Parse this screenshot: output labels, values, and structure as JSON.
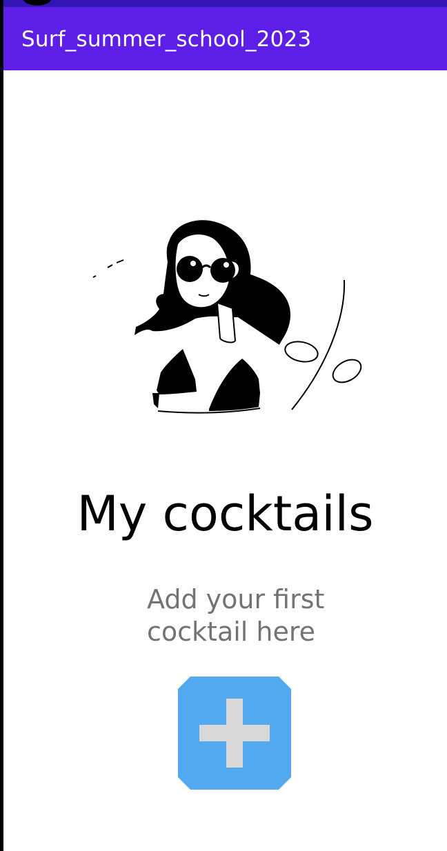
{
  "app_bar": {
    "title": "Surf_summer_school_2023"
  },
  "empty_state": {
    "title": "My cocktails",
    "subtitle_line1": "Add your first",
    "subtitle_line2": "cocktail here",
    "illustration_icon": "woman-with-sunglasses-illustration"
  },
  "add_button": {
    "icon": "plus-icon"
  },
  "colors": {
    "status_bar": "#3416b5",
    "app_bar": "#5d1fe8",
    "app_bar_text": "#ffffff",
    "subtitle_text": "#737373",
    "add_button": "#53a9f0",
    "plus_icon": "#d8d8d8"
  }
}
